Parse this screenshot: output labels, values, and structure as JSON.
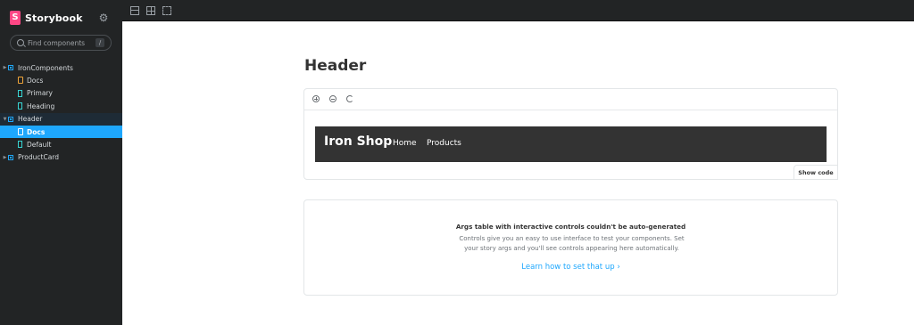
{
  "sidebar": {
    "brand": "Storybook",
    "brand_logo_letter": "S",
    "search_placeholder": "Find components",
    "search_shortcut": "/",
    "tree": [
      {
        "label": "IronComponents",
        "type": "component",
        "level": 0
      },
      {
        "label": "Docs",
        "type": "docs",
        "level": 1
      },
      {
        "label": "Primary",
        "type": "story",
        "level": 1
      },
      {
        "label": "Heading",
        "type": "story",
        "level": 1
      },
      {
        "label": "Header",
        "type": "component",
        "level": 0,
        "state": "expanded-selected"
      },
      {
        "label": "Docs",
        "type": "docs",
        "level": 1,
        "state": "active"
      },
      {
        "label": "Default",
        "type": "story",
        "level": 1
      },
      {
        "label": "ProductCard",
        "type": "component",
        "level": 0
      }
    ]
  },
  "toolbar": {
    "icons": [
      "grid-icon",
      "zoom-icon",
      "outline-icon"
    ]
  },
  "main": {
    "title": "Header",
    "preview": {
      "brand": "Iron Shop",
      "nav": [
        "Home",
        "Products"
      ],
      "show_code": "Show code"
    },
    "args": {
      "title": "Args table with interactive controls couldn't be auto-generated",
      "text": "Controls give you an easy to use interface to test your components. Set your story args and you'll see controls appearing here automatically.",
      "link": "Learn how to set that up ›"
    }
  },
  "colors": {
    "sidebar_bg": "#222425",
    "accent": "#1ea7fd",
    "brand": "#ff4785",
    "preview_header_bg": "#333333"
  }
}
